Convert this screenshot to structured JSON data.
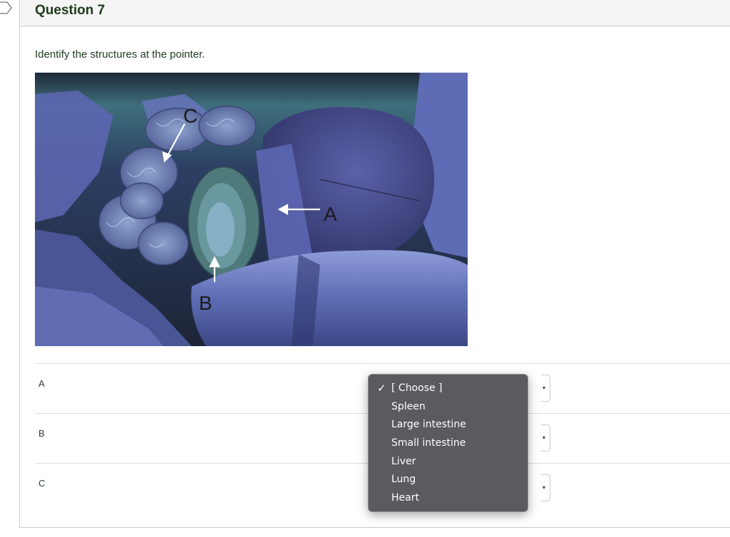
{
  "question": {
    "title": "Question 7",
    "prompt": "Identify the structures at the pointer."
  },
  "image": {
    "labels": {
      "a": "A",
      "b": "B",
      "c": "C"
    }
  },
  "answers": [
    {
      "label": "A"
    },
    {
      "label": "B"
    },
    {
      "label": "C"
    }
  ],
  "dropdown": {
    "selected_index": 0,
    "check_glyph": "✓",
    "options": [
      "[ Choose ]",
      "Spleen",
      "Large intestine",
      "Small intestine",
      "Liver",
      "Lung",
      "Heart"
    ]
  },
  "colors": {
    "title_text": "#1e3a1e",
    "menu_bg": "#5b5b5f",
    "menu_text": "#ffffff"
  }
}
